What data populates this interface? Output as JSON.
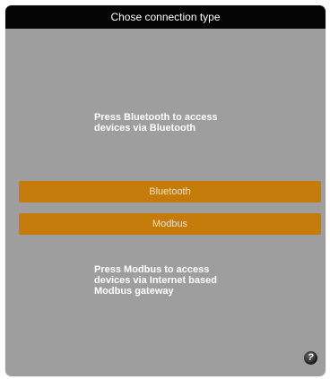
{
  "dialog": {
    "title": "Chose connection type",
    "bluetooth_description_line1": "Press Bluetooth to access",
    "bluetooth_description_line2": "devices via Bluetooth",
    "bluetooth_button_label": "Bluetooth",
    "modbus_button_label": "Modbus",
    "modbus_description_line1": "Press Modbus to access",
    "modbus_description_line2": "devices via Internet based",
    "modbus_description_line3": "Modbus gateway",
    "help_glyph": "?"
  },
  "colors": {
    "title_bar": "#050505",
    "background": "#9e9e9e",
    "button": "#c47b0a"
  },
  "icons": {
    "help": "help-icon"
  }
}
